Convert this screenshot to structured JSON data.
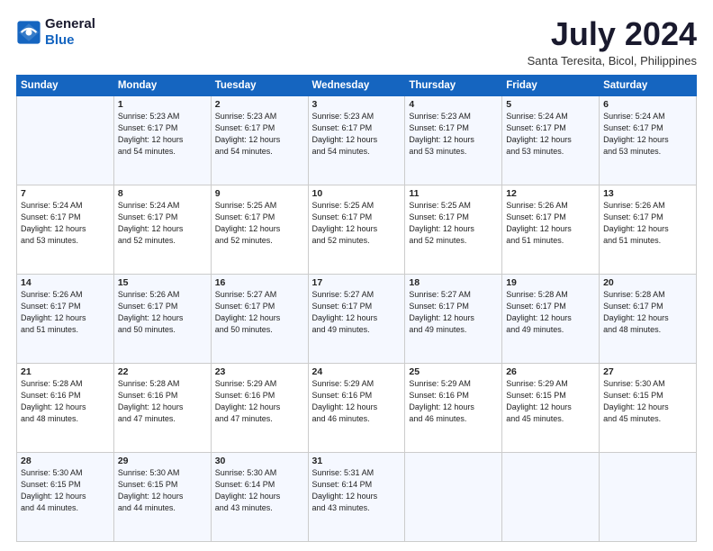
{
  "header": {
    "logo_line1": "General",
    "logo_line2": "Blue",
    "month_year": "July 2024",
    "location": "Santa Teresita, Bicol, Philippines"
  },
  "days_of_week": [
    "Sunday",
    "Monday",
    "Tuesday",
    "Wednesday",
    "Thursday",
    "Friday",
    "Saturday"
  ],
  "weeks": [
    [
      {
        "day": "",
        "info": ""
      },
      {
        "day": "1",
        "info": "Sunrise: 5:23 AM\nSunset: 6:17 PM\nDaylight: 12 hours\nand 54 minutes."
      },
      {
        "day": "2",
        "info": "Sunrise: 5:23 AM\nSunset: 6:17 PM\nDaylight: 12 hours\nand 54 minutes."
      },
      {
        "day": "3",
        "info": "Sunrise: 5:23 AM\nSunset: 6:17 PM\nDaylight: 12 hours\nand 54 minutes."
      },
      {
        "day": "4",
        "info": "Sunrise: 5:23 AM\nSunset: 6:17 PM\nDaylight: 12 hours\nand 53 minutes."
      },
      {
        "day": "5",
        "info": "Sunrise: 5:24 AM\nSunset: 6:17 PM\nDaylight: 12 hours\nand 53 minutes."
      },
      {
        "day": "6",
        "info": "Sunrise: 5:24 AM\nSunset: 6:17 PM\nDaylight: 12 hours\nand 53 minutes."
      }
    ],
    [
      {
        "day": "7",
        "info": "Sunrise: 5:24 AM\nSunset: 6:17 PM\nDaylight: 12 hours\nand 53 minutes."
      },
      {
        "day": "8",
        "info": "Sunrise: 5:24 AM\nSunset: 6:17 PM\nDaylight: 12 hours\nand 52 minutes."
      },
      {
        "day": "9",
        "info": "Sunrise: 5:25 AM\nSunset: 6:17 PM\nDaylight: 12 hours\nand 52 minutes."
      },
      {
        "day": "10",
        "info": "Sunrise: 5:25 AM\nSunset: 6:17 PM\nDaylight: 12 hours\nand 52 minutes."
      },
      {
        "day": "11",
        "info": "Sunrise: 5:25 AM\nSunset: 6:17 PM\nDaylight: 12 hours\nand 52 minutes."
      },
      {
        "day": "12",
        "info": "Sunrise: 5:26 AM\nSunset: 6:17 PM\nDaylight: 12 hours\nand 51 minutes."
      },
      {
        "day": "13",
        "info": "Sunrise: 5:26 AM\nSunset: 6:17 PM\nDaylight: 12 hours\nand 51 minutes."
      }
    ],
    [
      {
        "day": "14",
        "info": "Sunrise: 5:26 AM\nSunset: 6:17 PM\nDaylight: 12 hours\nand 51 minutes."
      },
      {
        "day": "15",
        "info": "Sunrise: 5:26 AM\nSunset: 6:17 PM\nDaylight: 12 hours\nand 50 minutes."
      },
      {
        "day": "16",
        "info": "Sunrise: 5:27 AM\nSunset: 6:17 PM\nDaylight: 12 hours\nand 50 minutes."
      },
      {
        "day": "17",
        "info": "Sunrise: 5:27 AM\nSunset: 6:17 PM\nDaylight: 12 hours\nand 49 minutes."
      },
      {
        "day": "18",
        "info": "Sunrise: 5:27 AM\nSunset: 6:17 PM\nDaylight: 12 hours\nand 49 minutes."
      },
      {
        "day": "19",
        "info": "Sunrise: 5:28 AM\nSunset: 6:17 PM\nDaylight: 12 hours\nand 49 minutes."
      },
      {
        "day": "20",
        "info": "Sunrise: 5:28 AM\nSunset: 6:17 PM\nDaylight: 12 hours\nand 48 minutes."
      }
    ],
    [
      {
        "day": "21",
        "info": "Sunrise: 5:28 AM\nSunset: 6:16 PM\nDaylight: 12 hours\nand 48 minutes."
      },
      {
        "day": "22",
        "info": "Sunrise: 5:28 AM\nSunset: 6:16 PM\nDaylight: 12 hours\nand 47 minutes."
      },
      {
        "day": "23",
        "info": "Sunrise: 5:29 AM\nSunset: 6:16 PM\nDaylight: 12 hours\nand 47 minutes."
      },
      {
        "day": "24",
        "info": "Sunrise: 5:29 AM\nSunset: 6:16 PM\nDaylight: 12 hours\nand 46 minutes."
      },
      {
        "day": "25",
        "info": "Sunrise: 5:29 AM\nSunset: 6:16 PM\nDaylight: 12 hours\nand 46 minutes."
      },
      {
        "day": "26",
        "info": "Sunrise: 5:29 AM\nSunset: 6:15 PM\nDaylight: 12 hours\nand 45 minutes."
      },
      {
        "day": "27",
        "info": "Sunrise: 5:30 AM\nSunset: 6:15 PM\nDaylight: 12 hours\nand 45 minutes."
      }
    ],
    [
      {
        "day": "28",
        "info": "Sunrise: 5:30 AM\nSunset: 6:15 PM\nDaylight: 12 hours\nand 44 minutes."
      },
      {
        "day": "29",
        "info": "Sunrise: 5:30 AM\nSunset: 6:15 PM\nDaylight: 12 hours\nand 44 minutes."
      },
      {
        "day": "30",
        "info": "Sunrise: 5:30 AM\nSunset: 6:14 PM\nDaylight: 12 hours\nand 43 minutes."
      },
      {
        "day": "31",
        "info": "Sunrise: 5:31 AM\nSunset: 6:14 PM\nDaylight: 12 hours\nand 43 minutes."
      },
      {
        "day": "",
        "info": ""
      },
      {
        "day": "",
        "info": ""
      },
      {
        "day": "",
        "info": ""
      }
    ]
  ]
}
